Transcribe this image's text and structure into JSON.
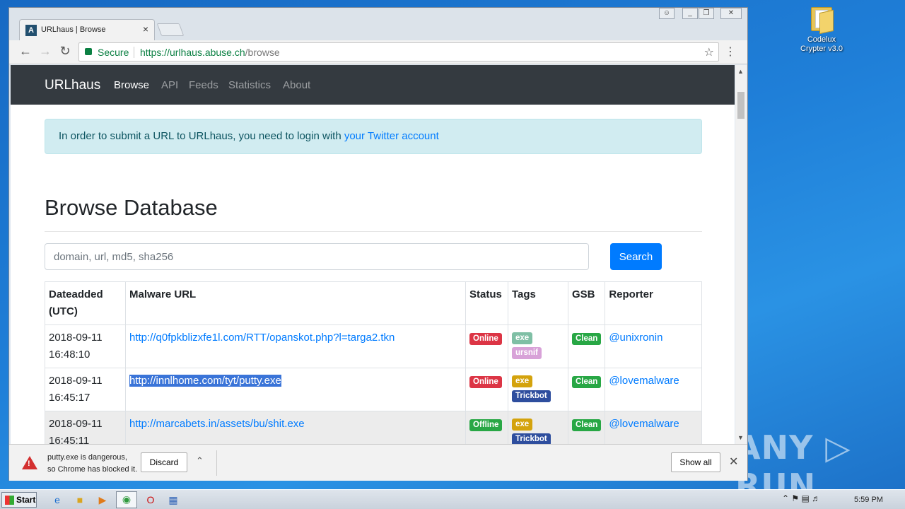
{
  "desktop": {
    "icon_label_line1": "Codelux",
    "icon_label_line2": "Crypter v3.0",
    "watermark": "ANY ▷ RUN"
  },
  "browser": {
    "tab_title": "URLhaus | Browse",
    "favicon_letter": "A",
    "secure_label": "Secure",
    "url_host": "https://urlhaus.abuse.ch",
    "url_path": "/browse"
  },
  "site": {
    "brand": "URLhaus",
    "nav": [
      "Browse",
      "API",
      "Feeds",
      "Statistics",
      "About"
    ],
    "alert_text": "In order to submit a URL to URLhaus, you need to login with ",
    "alert_link": "your Twitter account",
    "heading": "Browse Database",
    "search_placeholder": "domain, url, md5, sha256",
    "search_button": "Search",
    "columns": [
      "Dateadded (UTC)",
      "Malware URL",
      "Status",
      "Tags",
      "GSB",
      "Reporter"
    ],
    "rows": [
      {
        "date": "2018-09-11",
        "time": "16:48:10",
        "url": "http://q0fpkblizxfe1l.com/RTT/opanskot.php?l=targa2.tkn",
        "status": "Online",
        "tags": [
          "exe",
          "ursnif"
        ],
        "gsb": "Clean",
        "reporter": "@unixronin"
      },
      {
        "date": "2018-09-11",
        "time": "16:45:17",
        "url": "http://innlhome.com/tyt/putty.exe",
        "status": "Online",
        "tags": [
          "exe",
          "Trickbot"
        ],
        "gsb": "Clean",
        "reporter": "@lovemalware"
      },
      {
        "date": "2018-09-11",
        "time": "16:45:11",
        "url": "http://marcabets.in/assets/bu/shit.exe",
        "status": "Offline",
        "tags": [
          "exe",
          "Trickbot"
        ],
        "gsb": "Clean",
        "reporter": "@lovemalware"
      }
    ]
  },
  "download": {
    "line1": "putty.exe is dangerous,",
    "line2": "so Chrome has blocked it.",
    "discard": "Discard",
    "show_all": "Show all"
  },
  "taskbar": {
    "start": "Start",
    "clock": "5:59 PM"
  },
  "colors": {
    "online": "#dc3545",
    "offline": "#28a745",
    "clean": "#28a745",
    "exe": "#d4a30d",
    "ursnif": "#d8a2d8",
    "trickbot": "#2e4e9e"
  }
}
